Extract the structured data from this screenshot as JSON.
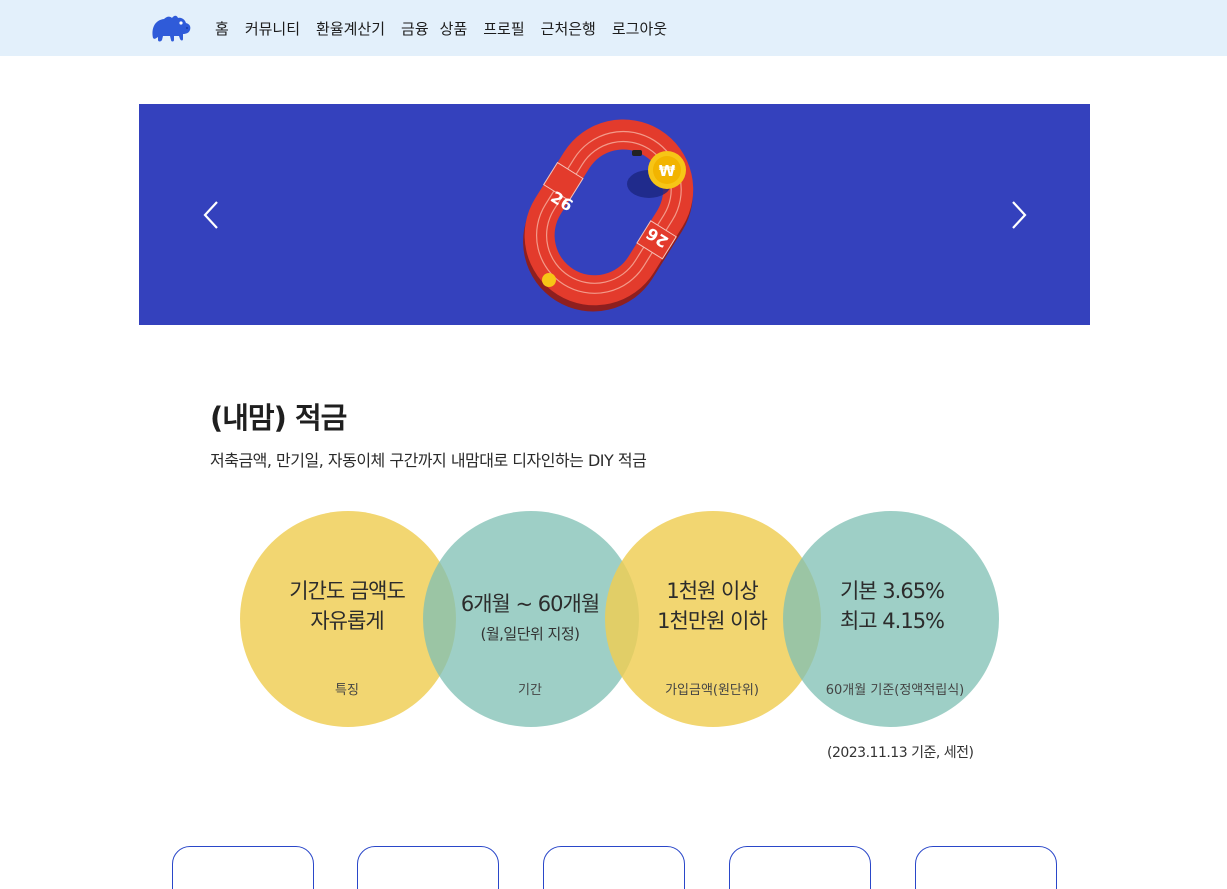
{
  "nav": {
    "logo_icon": "hippo-logo-icon",
    "items": [
      "홈",
      "커뮤니티",
      "환율계산기",
      "금융",
      "상품",
      "프로필",
      "근처은행",
      "로그아웃"
    ]
  },
  "banner": {
    "art_icon": "running-track-coin-illustration",
    "track_numbers": [
      "26",
      "26"
    ],
    "prev_icon": "chevron-left-icon",
    "next_icon": "chevron-right-icon"
  },
  "product": {
    "title": "(내맘) 적금",
    "description": "저축금액, 만기일, 자동이체 구간까지 내맘대로 디자인하는 DIY 적금",
    "features": [
      {
        "main": [
          "기간도 금액도",
          "자유롭게"
        ],
        "sub": "",
        "label": "특징"
      },
      {
        "main": [
          "6개월 ~ 60개월"
        ],
        "sub": "(월,일단위 지정)",
        "label": "기간"
      },
      {
        "main": [
          "1천원 이상",
          "1천만원 이하"
        ],
        "sub": "",
        "label": "가입금액(원단위)"
      },
      {
        "main": [
          "기본 3.65%",
          "최고 4.15%"
        ],
        "sub": "",
        "label": "60개월 기준(정액적립식)"
      }
    ],
    "basis_note": "(2023.11.13 기준, 세전)"
  },
  "colors": {
    "nav_bg": "#e3f0fb",
    "banner_bg": "#3441bd",
    "logo_blue": "#2f5bd9",
    "circle_yellow": "#efcd52",
    "circle_teal": "#7fc0b4",
    "card_border": "#2a47c9"
  }
}
